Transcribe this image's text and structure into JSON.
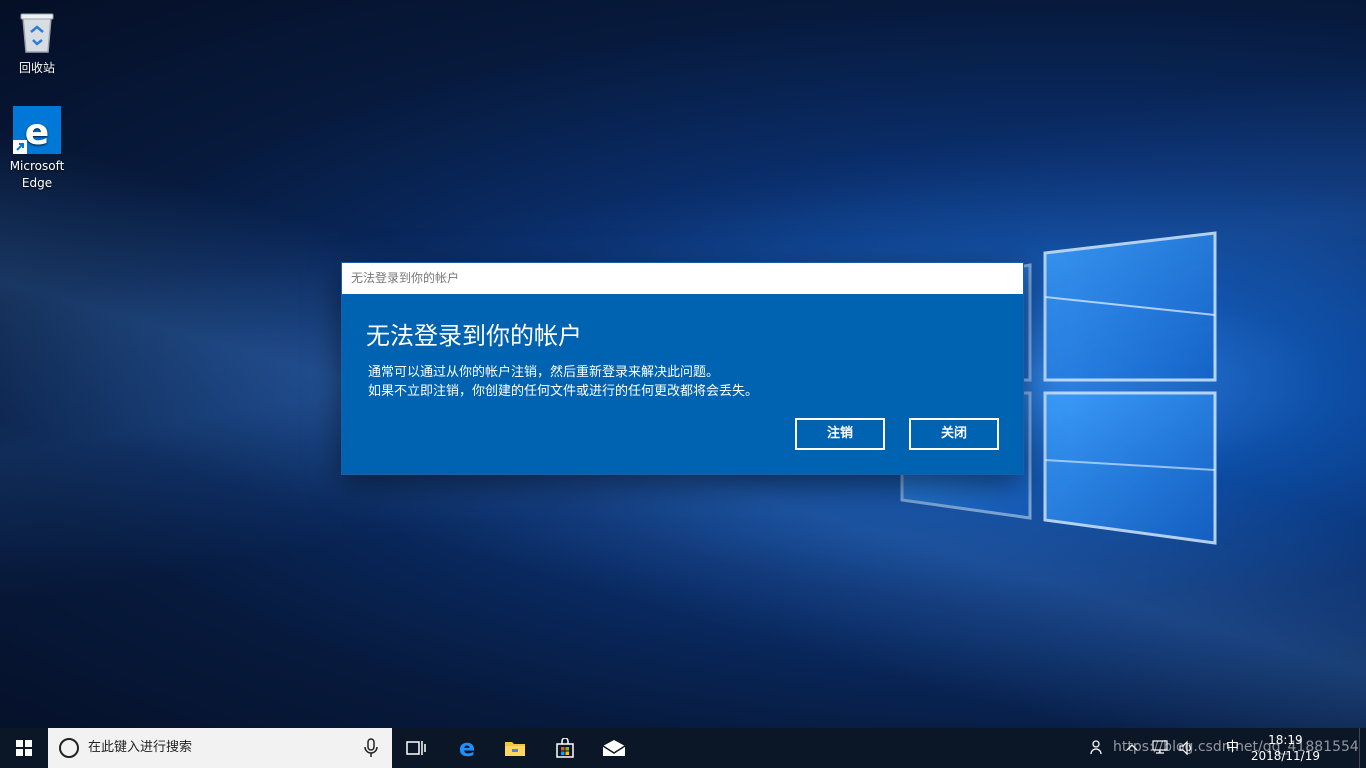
{
  "desktop": {
    "icons": [
      {
        "label": "回收站",
        "icon": "recycle-bin-icon"
      },
      {
        "label": "Microsoft Edge",
        "icon": "edge-icon"
      }
    ]
  },
  "dialog": {
    "titlebar": "无法登录到你的帐户",
    "heading": "无法登录到你的帐户",
    "line1": "通常可以通过从你的帐户注销，然后重新登录来解决此问题。",
    "line2": "如果不立即注销，你创建的任何文件或进行的任何更改都将会丢失。",
    "sign_out_label": "注销",
    "close_label": "关闭"
  },
  "taskbar": {
    "search_placeholder": "在此键入进行搜索",
    "apps": [
      "task-view-icon",
      "edge-icon",
      "file-explorer-icon",
      "store-icon",
      "mail-icon"
    ],
    "tray_ime": "中",
    "clock_time": "18:19",
    "clock_date": "2018/11/19"
  },
  "watermark": "https://blog.csdn.net/qq_41881554",
  "colors": {
    "dialog_bg": "#0063b1",
    "taskbar_bg": "#0b1626",
    "accent": "#0078d7"
  }
}
